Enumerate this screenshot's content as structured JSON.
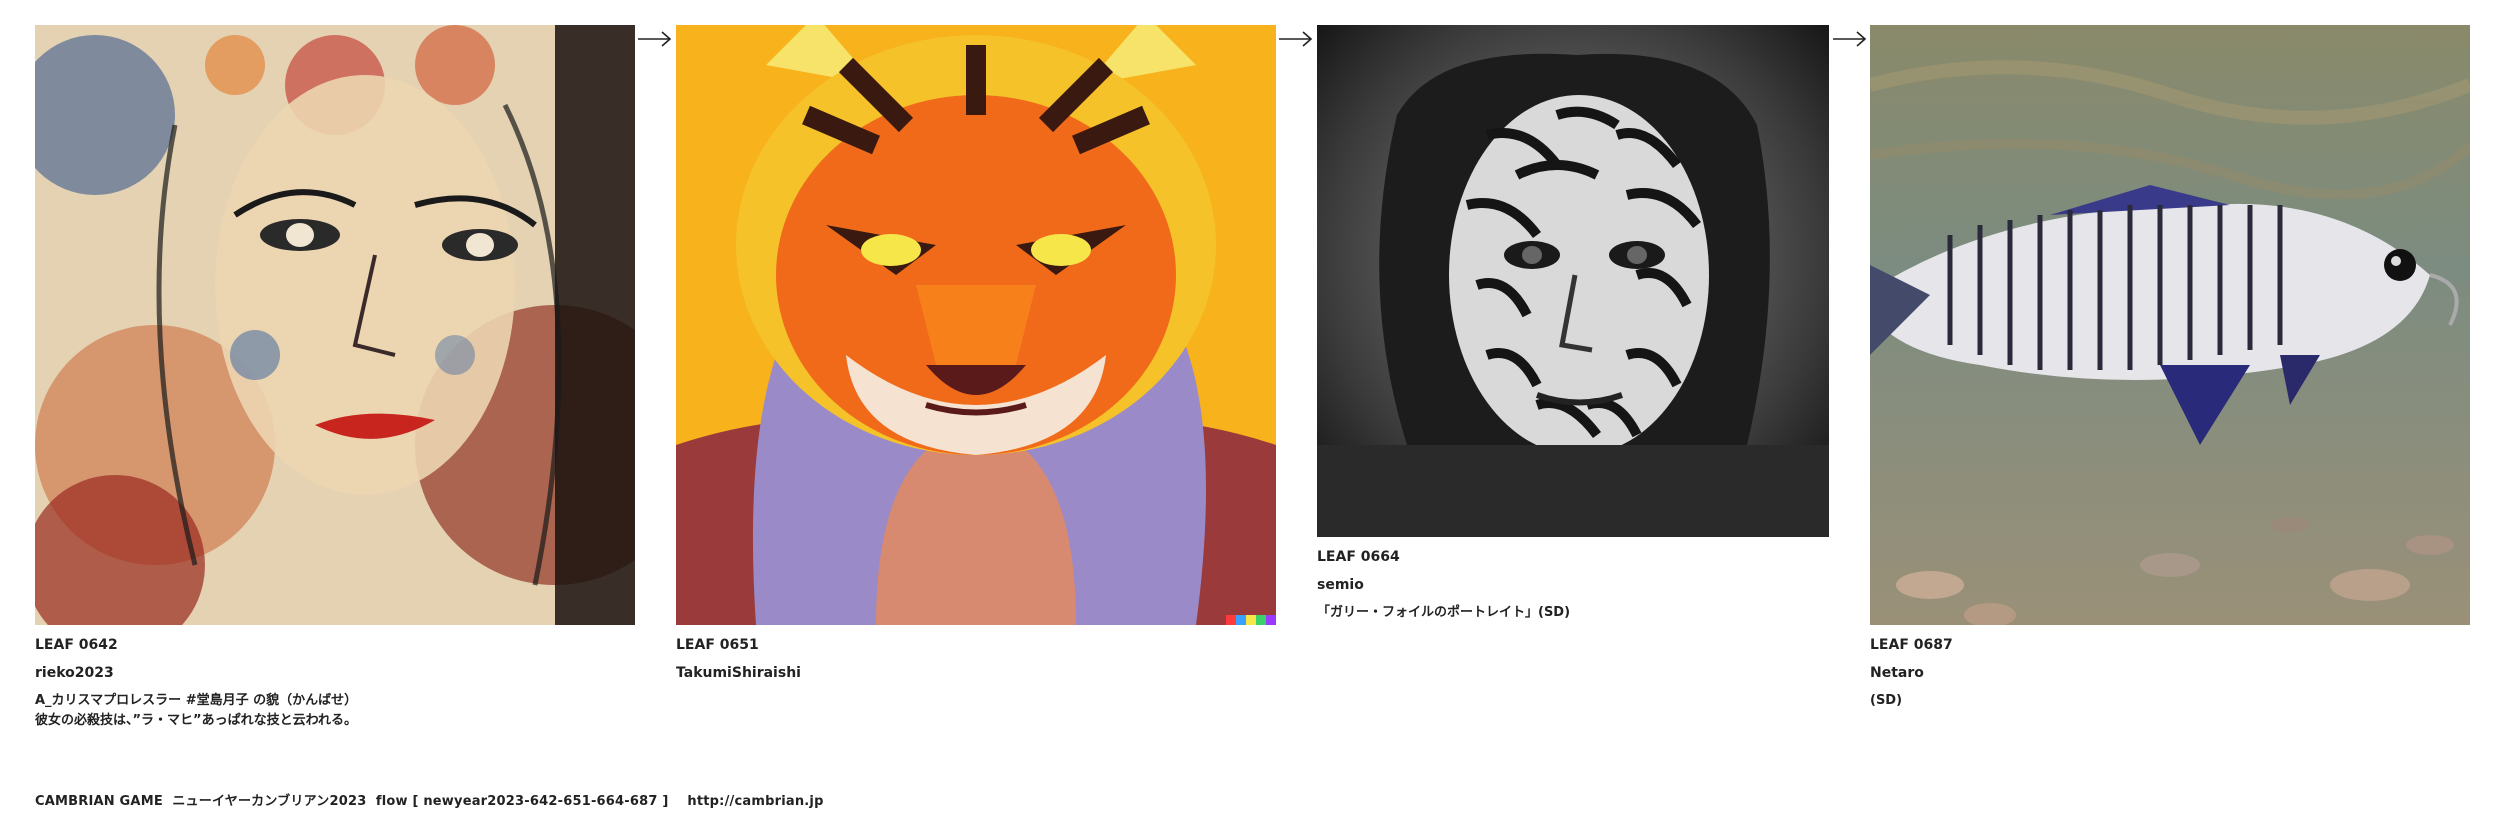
{
  "cards": [
    {
      "leaf": "LEAF 0642",
      "author": "rieko2023",
      "description": "A_カリスマプロレスラー #堂島月子 の貌（かんばせ）\n彼女の必殺技は、”ラ・マヒ”あっぱれな技と云われる。",
      "image": "painted-woman-portrait"
    },
    {
      "leaf": "LEAF 0651",
      "author": "TakumiShiraishi",
      "description": "",
      "image": "tiger-character"
    },
    {
      "leaf": "LEAF 0664",
      "author": "semio",
      "description": "「ガリー・フォイルのポートレイト」(SD)",
      "image": "tattooed-face-photo"
    },
    {
      "leaf": "LEAF 0687",
      "author": "Netaro",
      "description": "(SD)",
      "image": "striped-fish-underwater"
    }
  ],
  "arrows": [
    "arrow-icon",
    "arrow-icon",
    "arrow-icon"
  ],
  "footer": {
    "text": "CAMBRIAN GAME  ニューイヤーカンブリアン2023  flow [ newyear2023-642-651-664-687 ]    http://cambrian.jp"
  }
}
